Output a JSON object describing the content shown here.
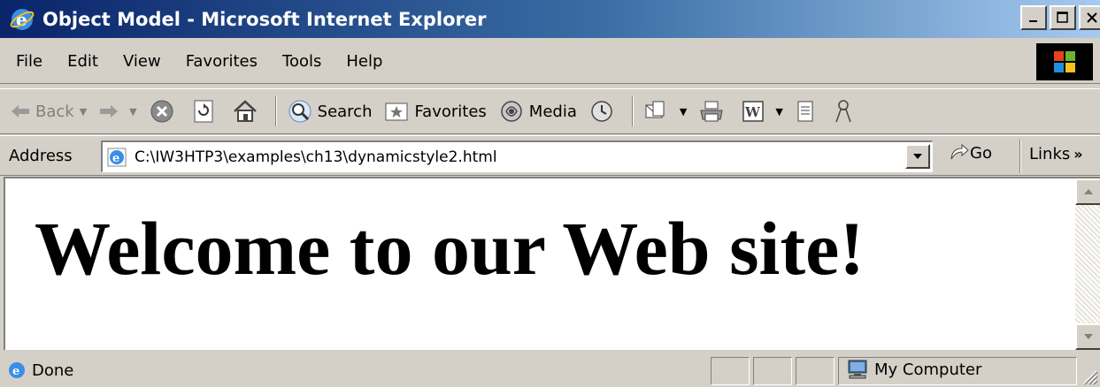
{
  "window": {
    "title": "Object Model - Microsoft Internet Explorer"
  },
  "menu": [
    "File",
    "Edit",
    "View",
    "Favorites",
    "Tools",
    "Help"
  ],
  "toolbar": {
    "back_label": "Back",
    "search_label": "Search",
    "favorites_label": "Favorites",
    "media_label": "Media"
  },
  "address": {
    "label": "Address",
    "url": "C:\\IW3HTP3\\examples\\ch13\\dynamicstyle2.html",
    "go_label": "Go",
    "links_label": "Links"
  },
  "page": {
    "heading": "Welcome to our Web site!"
  },
  "status": {
    "text": "Done",
    "zone": "My Computer"
  },
  "colors": {
    "titlebar_start": "#0a246a",
    "titlebar_end": "#a6caf0",
    "chrome": "#d4d0c8"
  }
}
